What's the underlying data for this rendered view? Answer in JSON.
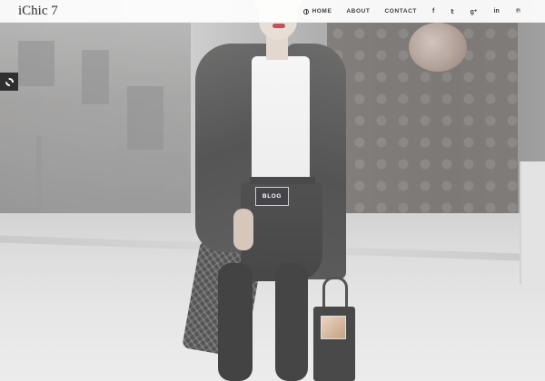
{
  "header": {
    "logo": "iChic 7",
    "nav": [
      {
        "label": "HOME",
        "icon": "globe-icon"
      },
      {
        "label": "ABOUT"
      },
      {
        "label": "CONTACT"
      }
    ],
    "social": [
      {
        "icon": "facebook-icon",
        "glyph": "f"
      },
      {
        "icon": "twitter-icon",
        "glyph": "𝕥"
      },
      {
        "icon": "google-plus-icon",
        "glyph": "g⁺"
      },
      {
        "icon": "linkedin-icon",
        "glyph": "in"
      },
      {
        "icon": "pinterest-icon",
        "glyph": "℗"
      }
    ]
  },
  "hero": {
    "button_label": "BLOG"
  },
  "settings": {
    "icon": "gear-icon"
  }
}
